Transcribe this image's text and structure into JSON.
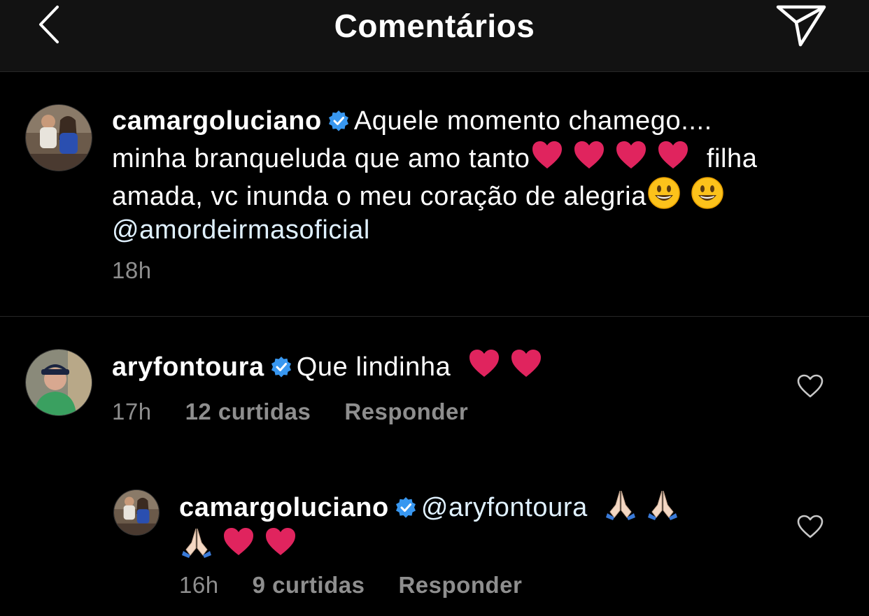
{
  "header": {
    "title": "Comentários",
    "back_icon": "chevron-left-icon",
    "send_icon": "paper-plane-icon"
  },
  "caption": {
    "username": "camargoluciano",
    "line1": "Aquele momento chamego....",
    "line2_a": "minha branqueluda que amo tanto",
    "line2_b": "filha",
    "line3": "amada, vc inunda o meu coração de alegria",
    "mention": "@amordeirmasoficial",
    "time": "18h"
  },
  "comments": [
    {
      "username": "aryfontoura",
      "text": "Que lindinha",
      "time": "17h",
      "likes": "12 curtidas",
      "reply_label": "Responder"
    },
    {
      "username": "camargoluciano",
      "mention": "@aryfontoura",
      "time": "16h",
      "likes": "9 curtidas",
      "reply_label": "Responder"
    }
  ],
  "colors": {
    "background": "#000000",
    "header": "#121212",
    "meta": "#8e8e8e",
    "verified": "#3897f0",
    "heart": "#e0245e"
  }
}
